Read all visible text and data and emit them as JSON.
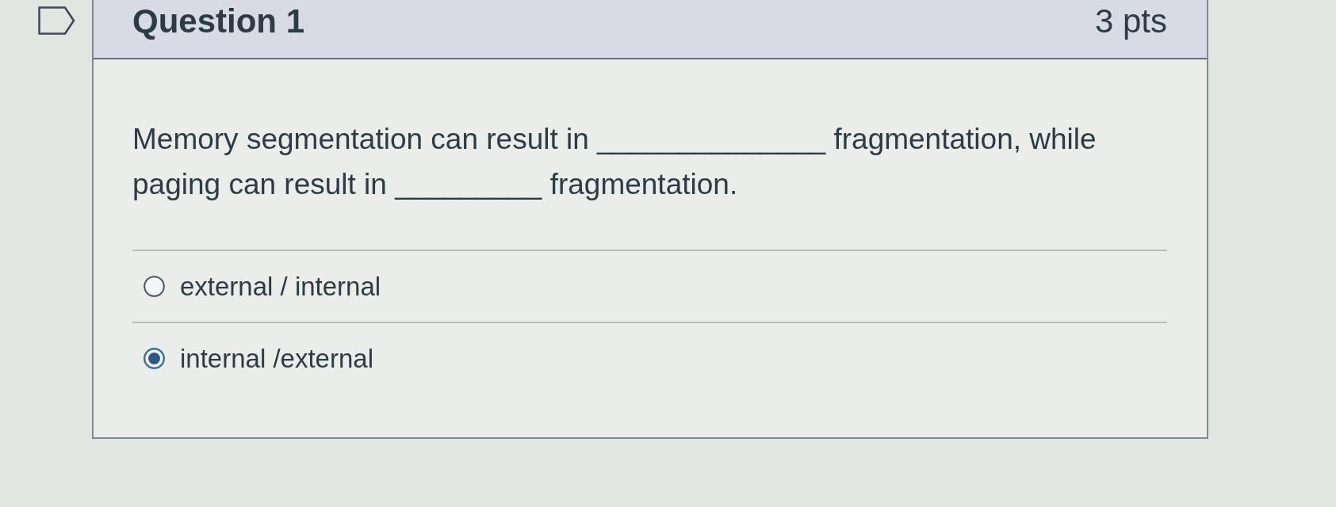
{
  "question": {
    "flagged": false,
    "title": "Question 1",
    "points": "3 pts",
    "text": "Memory segmentation can result in ______________ fragmentation, while paging can result in _________ fragmentation.",
    "options": [
      {
        "label": "external / internal",
        "selected": false
      },
      {
        "label": "internal /external",
        "selected": true
      }
    ]
  }
}
